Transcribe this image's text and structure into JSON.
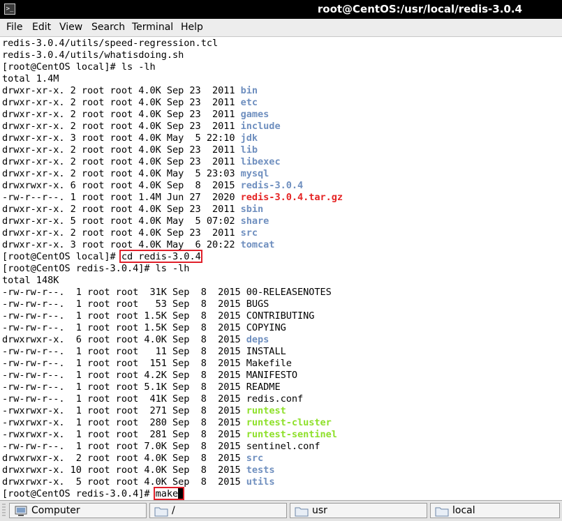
{
  "window": {
    "title": "root@CentOS:/usr/local/redis-3.0.4",
    "icon": "terminal-icon"
  },
  "menu": [
    "File",
    "Edit",
    "View",
    "Search",
    "Terminal",
    "Help"
  ],
  "colors": {
    "dir": "#6f8fbf",
    "archive": "#e52424",
    "exec": "#8ee02a",
    "highlight": "#e0202a"
  },
  "terminal": {
    "lines": [
      {
        "segs": [
          {
            "text": "redis-3.0.4/utils/speed-regression.tcl"
          }
        ]
      },
      {
        "segs": [
          {
            "text": "redis-3.0.4/utils/whatisdoing.sh"
          }
        ]
      },
      {
        "segs": [
          {
            "text": "[root@CentOS local]# ls -lh"
          }
        ]
      },
      {
        "segs": [
          {
            "text": "total 1.4M"
          }
        ]
      },
      {
        "segs": [
          {
            "text": "drwxr-xr-x. 2 root root 4.0K Sep 23  2011 "
          },
          {
            "text": "bin",
            "cls": "dir"
          }
        ]
      },
      {
        "segs": [
          {
            "text": "drwxr-xr-x. 2 root root 4.0K Sep 23  2011 "
          },
          {
            "text": "etc",
            "cls": "dir"
          }
        ]
      },
      {
        "segs": [
          {
            "text": "drwxr-xr-x. 2 root root 4.0K Sep 23  2011 "
          },
          {
            "text": "games",
            "cls": "dir"
          }
        ]
      },
      {
        "segs": [
          {
            "text": "drwxr-xr-x. 2 root root 4.0K Sep 23  2011 "
          },
          {
            "text": "include",
            "cls": "dir"
          }
        ]
      },
      {
        "segs": [
          {
            "text": "drwxr-xr-x. 3 root root 4.0K May  5 22:10 "
          },
          {
            "text": "jdk",
            "cls": "dir"
          }
        ]
      },
      {
        "segs": [
          {
            "text": "drwxr-xr-x. 2 root root 4.0K Sep 23  2011 "
          },
          {
            "text": "lib",
            "cls": "dir"
          }
        ]
      },
      {
        "segs": [
          {
            "text": "drwxr-xr-x. 2 root root 4.0K Sep 23  2011 "
          },
          {
            "text": "libexec",
            "cls": "dir"
          }
        ]
      },
      {
        "segs": [
          {
            "text": "drwxr-xr-x. 2 root root 4.0K May  5 23:03 "
          },
          {
            "text": "mysql",
            "cls": "dir"
          }
        ]
      },
      {
        "segs": [
          {
            "text": "drwxrwxr-x. 6 root root 4.0K Sep  8  2015 "
          },
          {
            "text": "redis-3.0.4",
            "cls": "dir"
          }
        ]
      },
      {
        "segs": [
          {
            "text": "-rw-r--r--. 1 root root 1.4M Jun 27  2020 "
          },
          {
            "text": "redis-3.0.4.tar.gz",
            "cls": "arc"
          }
        ]
      },
      {
        "segs": [
          {
            "text": "drwxr-xr-x. 2 root root 4.0K Sep 23  2011 "
          },
          {
            "text": "sbin",
            "cls": "dir"
          }
        ]
      },
      {
        "segs": [
          {
            "text": "drwxr-xr-x. 5 root root 4.0K May  5 07:02 "
          },
          {
            "text": "share",
            "cls": "dir"
          }
        ]
      },
      {
        "segs": [
          {
            "text": "drwxr-xr-x. 2 root root 4.0K Sep 23  2011 "
          },
          {
            "text": "src",
            "cls": "dir"
          }
        ]
      },
      {
        "segs": [
          {
            "text": "drwxr-xr-x. 3 root root 4.0K May  6 20:22 "
          },
          {
            "text": "tomcat",
            "cls": "dir"
          }
        ]
      },
      {
        "segs": [
          {
            "text": "[root@CentOS local]# "
          },
          {
            "text": "cd redis-3.0.4",
            "cls": "hl"
          }
        ]
      },
      {
        "segs": [
          {
            "text": "[root@CentOS redis-3.0.4]# ls -lh"
          }
        ]
      },
      {
        "segs": [
          {
            "text": "total 148K"
          }
        ]
      },
      {
        "segs": [
          {
            "text": "-rw-rw-r--.  1 root root  31K Sep  8  2015 00-RELEASENOTES"
          }
        ]
      },
      {
        "segs": [
          {
            "text": "-rw-rw-r--.  1 root root   53 Sep  8  2015 BUGS"
          }
        ]
      },
      {
        "segs": [
          {
            "text": "-rw-rw-r--.  1 root root 1.5K Sep  8  2015 CONTRIBUTING"
          }
        ]
      },
      {
        "segs": [
          {
            "text": "-rw-rw-r--.  1 root root 1.5K Sep  8  2015 COPYING"
          }
        ]
      },
      {
        "segs": [
          {
            "text": "drwxrwxr-x.  6 root root 4.0K Sep  8  2015 "
          },
          {
            "text": "deps",
            "cls": "dir"
          }
        ]
      },
      {
        "segs": [
          {
            "text": "-rw-rw-r--.  1 root root   11 Sep  8  2015 INSTALL"
          }
        ]
      },
      {
        "segs": [
          {
            "text": "-rw-rw-r--.  1 root root  151 Sep  8  2015 Makefile"
          }
        ]
      },
      {
        "segs": [
          {
            "text": "-rw-rw-r--.  1 root root 4.2K Sep  8  2015 MANIFESTO"
          }
        ]
      },
      {
        "segs": [
          {
            "text": "-rw-rw-r--.  1 root root 5.1K Sep  8  2015 README"
          }
        ]
      },
      {
        "segs": [
          {
            "text": "-rw-rw-r--.  1 root root  41K Sep  8  2015 redis.conf"
          }
        ]
      },
      {
        "segs": [
          {
            "text": "-rwxrwxr-x.  1 root root  271 Sep  8  2015 "
          },
          {
            "text": "runtest",
            "cls": "exe"
          }
        ]
      },
      {
        "segs": [
          {
            "text": "-rwxrwxr-x.  1 root root  280 Sep  8  2015 "
          },
          {
            "text": "runtest-cluster",
            "cls": "exe"
          }
        ]
      },
      {
        "segs": [
          {
            "text": "-rwxrwxr-x.  1 root root  281 Sep  8  2015 "
          },
          {
            "text": "runtest-sentinel",
            "cls": "exe"
          }
        ]
      },
      {
        "segs": [
          {
            "text": "-rw-rw-r--.  1 root root 7.0K Sep  8  2015 sentinel.conf"
          }
        ]
      },
      {
        "segs": [
          {
            "text": "drwxrwxr-x.  2 root root 4.0K Sep  8  2015 "
          },
          {
            "text": "src",
            "cls": "dir"
          }
        ]
      },
      {
        "segs": [
          {
            "text": "drwxrwxr-x. 10 root root 4.0K Sep  8  2015 "
          },
          {
            "text": "tests",
            "cls": "dir"
          }
        ]
      },
      {
        "segs": [
          {
            "text": "drwxrwxr-x.  5 root root 4.0K Sep  8  2015 "
          },
          {
            "text": "utils",
            "cls": "dir"
          }
        ]
      },
      {
        "segs": [
          {
            "text": "[root@CentOS redis-3.0.4]# "
          },
          {
            "text": "make",
            "cls": "hl"
          }
        ],
        "cursor": true
      }
    ]
  },
  "taskbar": [
    {
      "label": "Computer",
      "icon": "computer-icon"
    },
    {
      "label": "/",
      "icon": "folder-icon"
    },
    {
      "label": "usr",
      "icon": "folder-icon"
    },
    {
      "label": "local",
      "icon": "folder-icon"
    }
  ]
}
